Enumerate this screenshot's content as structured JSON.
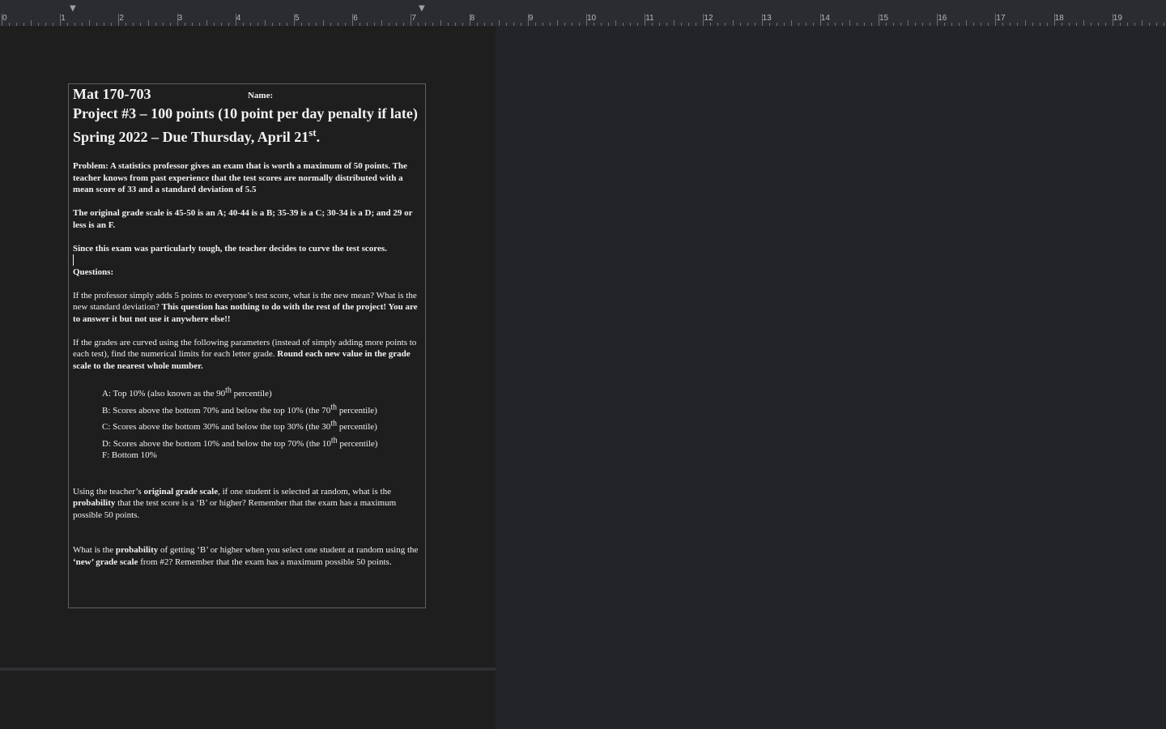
{
  "ruler": {
    "numbers": [
      "0",
      "1",
      "2",
      "3",
      "4",
      "5",
      "6",
      "7",
      "8",
      "9",
      "10",
      "11",
      "12",
      "13",
      "14",
      "15",
      "16",
      "17",
      "18",
      "19"
    ]
  },
  "document": {
    "course": "Mat 170-703",
    "name_label": "Name:",
    "project_line": "Project #3 – 100 points (10 point per day penalty if late)",
    "semester_line": "Spring 2022 – Due Thursday, April 21",
    "semester_sup": "st",
    "semester_tail": ".",
    "problem": "Problem: A statistics professor gives an exam that is worth a maximum of 50 points. The teacher knows from past experience that the test scores are normally distributed with a mean score of 33 and a standard deviation of 5.5",
    "grade_scale": "The original grade scale is 45-50 is an A; 40-44 is a B; 35-39 is a C; 30-34 is a D; and 29 or less is an F.",
    "curve_note": "Since this exam was particularly tough, the teacher decides to curve the test scores.",
    "questions_heading": "Questions:",
    "q1_plain": "If the professor simply adds 5 points to everyone’s test score, what is the new mean? What is the new standard deviation? ",
    "q1_bold": "This question has nothing to do with the rest of the project! You are to answer it but not use it anywhere else!!",
    "q2_plain": "If the grades are curved using the following parameters (instead of simply adding more points to each test), find the numerical limits for each letter grade. ",
    "q2_bold": "Round each new value in the grade scale to the nearest whole number.",
    "grades": [
      {
        "pre": "A: Top 10% (also known as the 90",
        "sup": "th",
        "post": " percentile)"
      },
      {
        "pre": "B: Scores above the bottom 70% and below the top 10% (the 70",
        "sup": "th",
        "post": " percentile)"
      },
      {
        "pre": "C: Scores above the bottom 30% and below the top 30% (the 30",
        "sup": "th",
        "post": " percentile)"
      },
      {
        "pre": "D: Scores above the bottom 10% and below the top 70% (the 10",
        "sup": "th",
        "post": " percentile)"
      },
      {
        "pre": "F: Bottom 10%",
        "sup": "",
        "post": ""
      }
    ],
    "q3": {
      "t1": "Using the teacher’s ",
      "b1": "original grade scale",
      "t2": ", if one student is selected at random, what is the ",
      "b2": "probability",
      "t3": " that the test score is a ‘B’ or higher? Remember that the exam has a maximum possible 50 points."
    },
    "q4": {
      "t1": "What is the ",
      "b1": "probability",
      "t2": " of getting ‘B’ or higher when you select one student at random using the ",
      "b2": "‘new’ grade scale",
      "t3": " from #2? Remember that the exam has a maximum possible 50 points."
    }
  }
}
